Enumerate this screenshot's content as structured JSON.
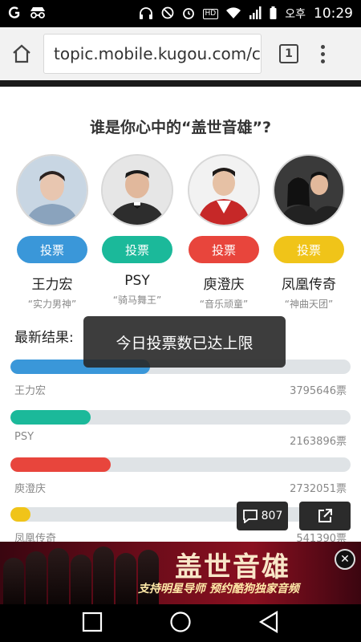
{
  "statusbar": {
    "time": "10:29",
    "carrier": "오후",
    "hd": "HD"
  },
  "browser": {
    "url": "topic.mobile.kugou.com/c",
    "tab_count": "1"
  },
  "page": {
    "question": "谁是你心中的“盖世音雄”?",
    "candidates": [
      {
        "name": "王力宏",
        "nickname": "“实力男神”",
        "vote_label": "投票",
        "color": "#3a97d9"
      },
      {
        "name": "PSY",
        "nickname": "“骑马舞王”",
        "vote_label": "投票",
        "color": "#1bb99a"
      },
      {
        "name": "庾澄庆",
        "nickname": "“音乐顽童”",
        "vote_label": "投票",
        "color": "#e8453c"
      },
      {
        "name": "凤凰传奇",
        "nickname": "“神曲天团”",
        "vote_label": "投票",
        "color": "#f0c419"
      }
    ],
    "results_title": "最新结果:",
    "results": [
      {
        "name": "王力宏",
        "count": "3795646票",
        "fraction": 0.41,
        "color": "#3a97d9"
      },
      {
        "name": "PSY",
        "count": "2163896票",
        "fraction": 0.235,
        "color": "#1bb99a"
      },
      {
        "name": "庾澄庆",
        "count": "2732051票",
        "fraction": 0.295,
        "color": "#e8453c"
      },
      {
        "name": "凤凰传奇",
        "count": "541390票",
        "fraction": 0.06,
        "color": "#f0c419"
      }
    ],
    "toast": "今日投票数已达上限",
    "comment_count": "807"
  },
  "banner": {
    "title": "盖世音雄",
    "subtitle": "支持明星导师  预约酷狗独家音频"
  }
}
